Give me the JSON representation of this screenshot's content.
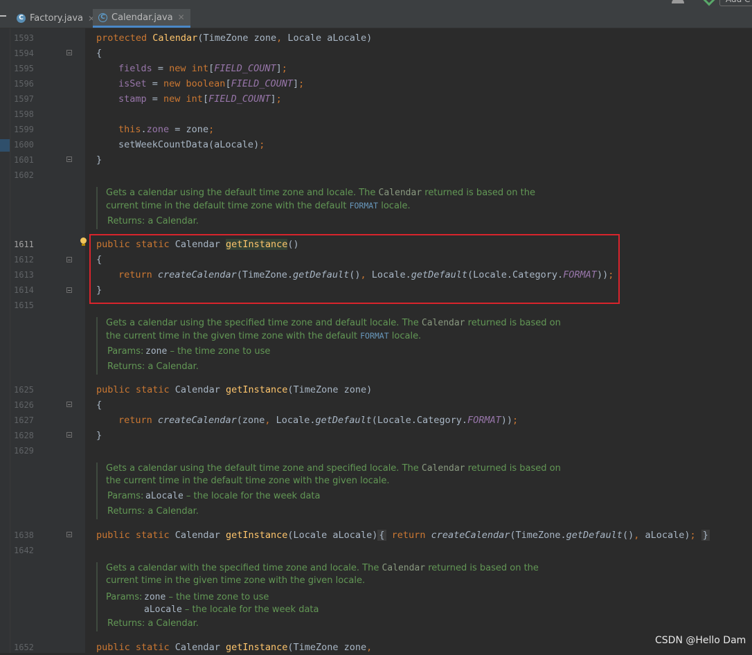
{
  "tabs": [
    {
      "label": "Factory.java",
      "icon": "java-class-icon"
    },
    {
      "label": "Calendar.java",
      "icon": "java-class-readonly-icon"
    }
  ],
  "toolbar": {
    "add_label": "Add C"
  },
  "gutter": {
    "l1593": "1593",
    "l1594": "1594",
    "l1595": "1595",
    "l1596": "1596",
    "l1597": "1597",
    "l1598": "1598",
    "l1599": "1599",
    "l1600": "1600",
    "l1601": "1601",
    "l1602": "1602",
    "l1611": "1611",
    "l1612": "1612",
    "l1613": "1613",
    "l1614": "1614",
    "l1615": "1615",
    "l1625": "1625",
    "l1626": "1626",
    "l1627": "1627",
    "l1628": "1628",
    "l1629": "1629",
    "l1638": "1638",
    "l1642": "1642",
    "l1652": "1652"
  },
  "code": {
    "c1593": {
      "kw": "protected ",
      "name": "Calendar",
      "rest": "(TimeZone zone",
      "comma": ",",
      "rest2": " Locale aLocale)"
    },
    "brace_open": "{",
    "brace_close": "}",
    "c1595": {
      "f": "fields",
      "eq": " = ",
      "kw": "new int",
      "b1": "[",
      "c": "FIELD_COUNT",
      "b2": "]",
      "s": ";"
    },
    "c1596": {
      "f": "isSet",
      "eq": " = ",
      "kw": "new boolean",
      "b1": "[",
      "c": "FIELD_COUNT",
      "b2": "]",
      "s": ";"
    },
    "c1597": {
      "f": "stamp",
      "eq": " = ",
      "kw": "new int",
      "b1": "[",
      "c": "FIELD_COUNT",
      "b2": "]",
      "s": ";"
    },
    "c1599": {
      "kw": "this",
      "dot": ".",
      "f": "zone",
      "rest": " = zone",
      "s": ";"
    },
    "c1600": {
      "call": "setWeekCountData(aLocale)",
      "s": ";"
    },
    "c1611": {
      "kw": "public static ",
      "type": "Calendar ",
      "name": "getInstance",
      "rest": "()"
    },
    "c1613": {
      "kw": "return ",
      "m1": "createCalendar",
      "a1": "(TimeZone.",
      "m2": "getDefault",
      "a2": "()",
      "comma": ",",
      "a3": " Locale.",
      "m3": "getDefault",
      "a4": "(Locale.Category.",
      "c": "FORMAT",
      "a5": "))",
      "s": ";"
    },
    "c1625": {
      "kw": "public static ",
      "type": "Calendar ",
      "name": "getInstance",
      "rest": "(TimeZone zone)"
    },
    "c1627": {
      "kw": "return ",
      "m1": "createCalendar",
      "a1": "(zone",
      "comma": ",",
      "a3": " Locale.",
      "m3": "getDefault",
      "a4": "(Locale.Category.",
      "c": "FORMAT",
      "a5": "))",
      "s": ";"
    },
    "c1638": {
      "kw": "public static ",
      "type": "Calendar ",
      "name": "getInstance",
      "rest": "(Locale aLocale)",
      "fb1": "{",
      "kw2": " return ",
      "m1": "createCalendar",
      "a1": "(TimeZone.",
      "m2": "getDefault",
      "a2": "()",
      "comma": ",",
      "a3": " aLocale)",
      "s": ";",
      "fb2": "}"
    },
    "c1652": {
      "kw": "public static ",
      "type": "Calendar ",
      "name": "getInstance",
      "rest": "(TimeZone zone",
      "comma": ","
    }
  },
  "docs": {
    "d1": {
      "l1a": "Gets a calendar using the default time zone and locale. The ",
      "l1m": "Calendar",
      "l1b": " returned is based on the",
      "l2a": "current time in the default time zone with the default ",
      "l2m": "FORMAT",
      "l2b": " locale.",
      "ret": "Returns: a Calendar."
    },
    "d2": {
      "l1a": "Gets a calendar using the specified time zone and default locale. The ",
      "l1m": "Calendar",
      "l1b": " returned is based on",
      "l2a": "the current time in the given time zone with the default ",
      "l2m": "FORMAT",
      "l2b": " locale.",
      "plabel": "Params:",
      "p1": "zone",
      "p1d": " – the time zone to use",
      "ret": "Returns: a Calendar."
    },
    "d3": {
      "l1a": "Gets a calendar using the default time zone and specified locale. The ",
      "l1m": "Calendar",
      "l1b": " returned is based on",
      "l2": "the current time in the default time zone with the given locale.",
      "plabel": "Params:",
      "p1": "aLocale",
      "p1d": " – the locale for the week data",
      "ret": "Returns: a Calendar."
    },
    "d4": {
      "l1a": "Gets a calendar with the specified time zone and locale. The ",
      "l1m": "Calendar",
      "l1b": " returned is based on the",
      "l2": "current time in the given time zone with the given locale.",
      "plabel": "Params:",
      "p1": "zone",
      "p1d": " – the time zone to use",
      "p2": "aLocale",
      "p2d": " – the locale for the week data",
      "ret": "Returns: a Calendar."
    }
  },
  "watermark": "CSDN @Hello Dam"
}
